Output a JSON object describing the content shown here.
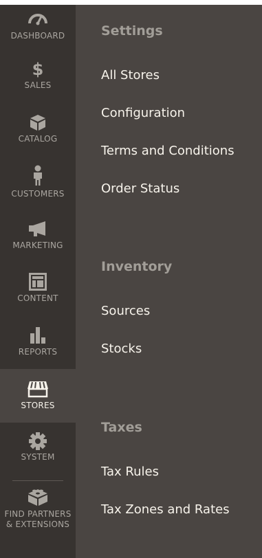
{
  "sidebar": {
    "items": [
      {
        "label": "DASHBOARD",
        "icon": "dashboard-icon"
      },
      {
        "label": "SALES",
        "icon": "dollar-icon"
      },
      {
        "label": "CATALOG",
        "icon": "box-icon"
      },
      {
        "label": "CUSTOMERS",
        "icon": "person-icon"
      },
      {
        "label": "MARKETING",
        "icon": "megaphone-icon"
      },
      {
        "label": "CONTENT",
        "icon": "layout-icon"
      },
      {
        "label": "REPORTS",
        "icon": "bar-chart-icon"
      },
      {
        "label": "STORES",
        "icon": "storefront-icon",
        "active": true
      },
      {
        "label": "SYSTEM",
        "icon": "gear-icon"
      },
      {
        "label": "FIND PARTNERS & EXTENSIONS",
        "icon": "blocks-icon"
      }
    ]
  },
  "flyout": {
    "sections": [
      {
        "title": "Settings",
        "links": [
          "All Stores",
          "Configuration",
          "Terms and Conditions",
          "Order Status"
        ]
      },
      {
        "title": "Inventory",
        "links": [
          "Sources",
          "Stocks"
        ]
      },
      {
        "title": "Taxes",
        "links": [
          "Tax Rules",
          "Tax Zones and Rates"
        ]
      }
    ]
  },
  "colors": {
    "sidebar_bg": "#373330",
    "flyout_bg": "#4a4542",
    "active_item_bg": "#4a4542",
    "section_title": "#a29e98",
    "link_text": "#f7f3eb",
    "nav_label": "#aaa6a0"
  }
}
